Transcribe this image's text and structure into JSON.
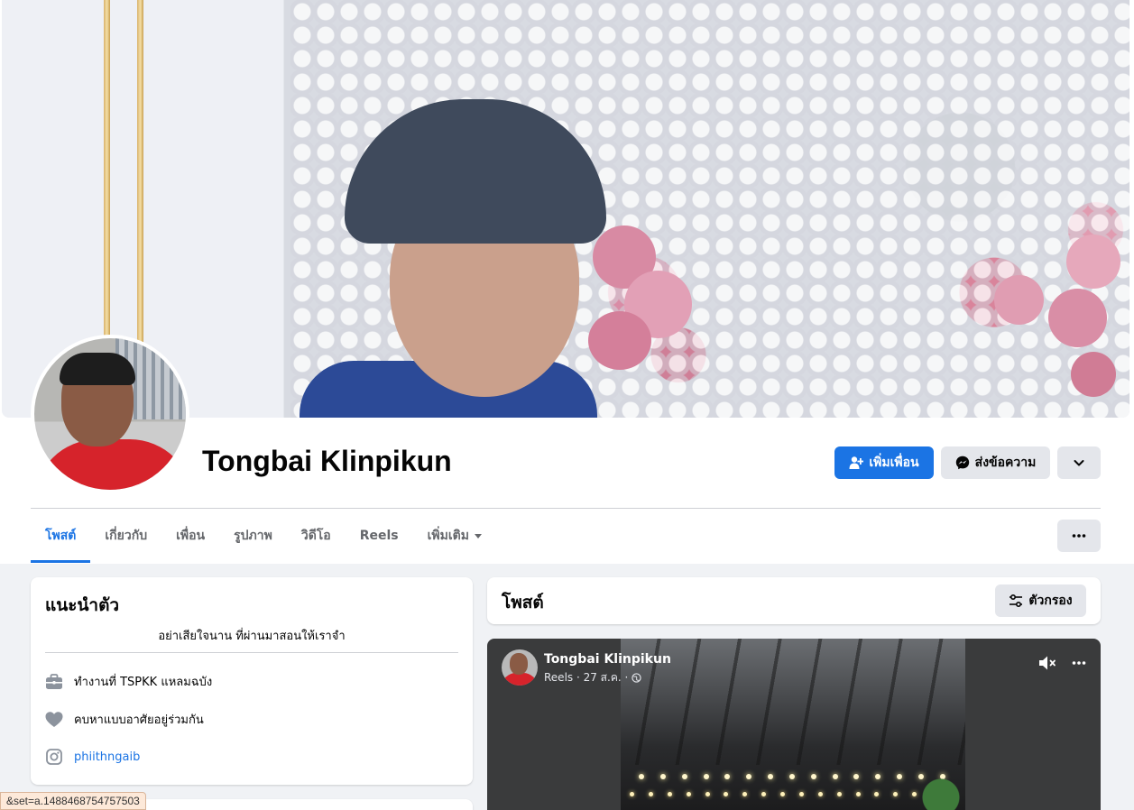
{
  "profile": {
    "name": "Tongbai Klinpikun"
  },
  "actions": {
    "add_friend_label": "เพิ่มเพื่อน",
    "message_label": "ส่งข้อความ"
  },
  "tabs": [
    {
      "label": "โพสต์",
      "active": true
    },
    {
      "label": "เกี่ยวกับ"
    },
    {
      "label": "เพื่อน"
    },
    {
      "label": "รูปภาพ"
    },
    {
      "label": "วิดีโอ"
    },
    {
      "label": "Reels"
    },
    {
      "label": "เพิ่มเติม"
    }
  ],
  "intro": {
    "title": "แนะนำตัว",
    "bio": "อย่าเสียใจนาน ที่ผ่านมาสอนให้เราจำ",
    "work": "ทำงานที่ TSPKK แหลมฉบัง",
    "relationship": "คบหาแบบอาศัยอยู่ร่วมกัน",
    "instagram": "phiithngaib"
  },
  "posts": {
    "title": "โพสต์",
    "filter_label": "ตัวกรอง"
  },
  "reel_post": {
    "author": "Tongbai Klinpikun",
    "meta": "Reels · 27 ส.ค. ·"
  },
  "status_bar": {
    "url": "&set=a.1488468754757503"
  },
  "colors": {
    "primary": "#1b74e4",
    "background": "#f0f2f5",
    "secondary_text": "#65676b"
  }
}
